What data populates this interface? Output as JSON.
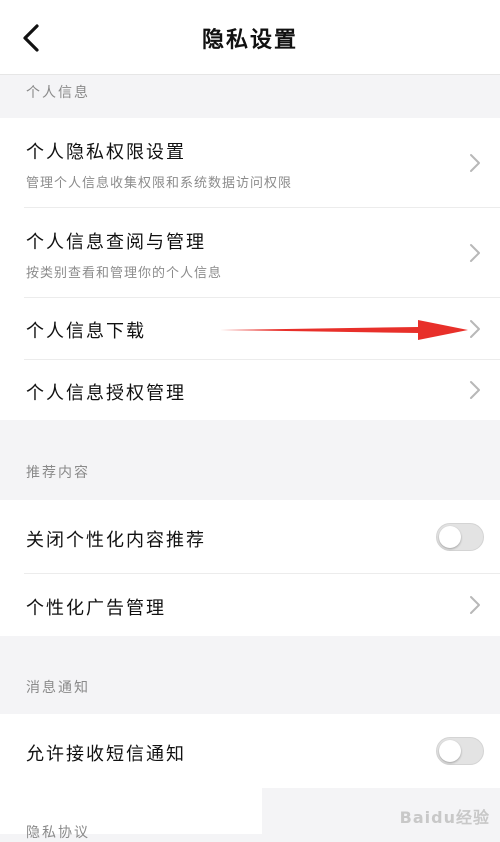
{
  "header": {
    "title": "隐私设置"
  },
  "sections": {
    "personal": {
      "title": "个人信息",
      "items": [
        {
          "label": "个人隐私权限设置",
          "subtitle": "管理个人信息收集权限和系统数据访问权限"
        },
        {
          "label": "个人信息查阅与管理",
          "subtitle": "按类别查看和管理你的个人信息"
        },
        {
          "label": "个人信息下载"
        },
        {
          "label": "个人信息授权管理"
        }
      ]
    },
    "recommend": {
      "title": "推荐内容",
      "items": [
        {
          "label": "关闭个性化内容推荐",
          "toggle": false
        },
        {
          "label": "个性化广告管理"
        }
      ]
    },
    "notify": {
      "title": "消息通知",
      "items": [
        {
          "label": "允许接收短信通知",
          "toggle": false
        }
      ]
    }
  },
  "annotation": {
    "color": "#e8302a"
  },
  "watermark": {
    "text": "Baidu经验"
  },
  "partial_section": {
    "title": "隐私协议"
  }
}
